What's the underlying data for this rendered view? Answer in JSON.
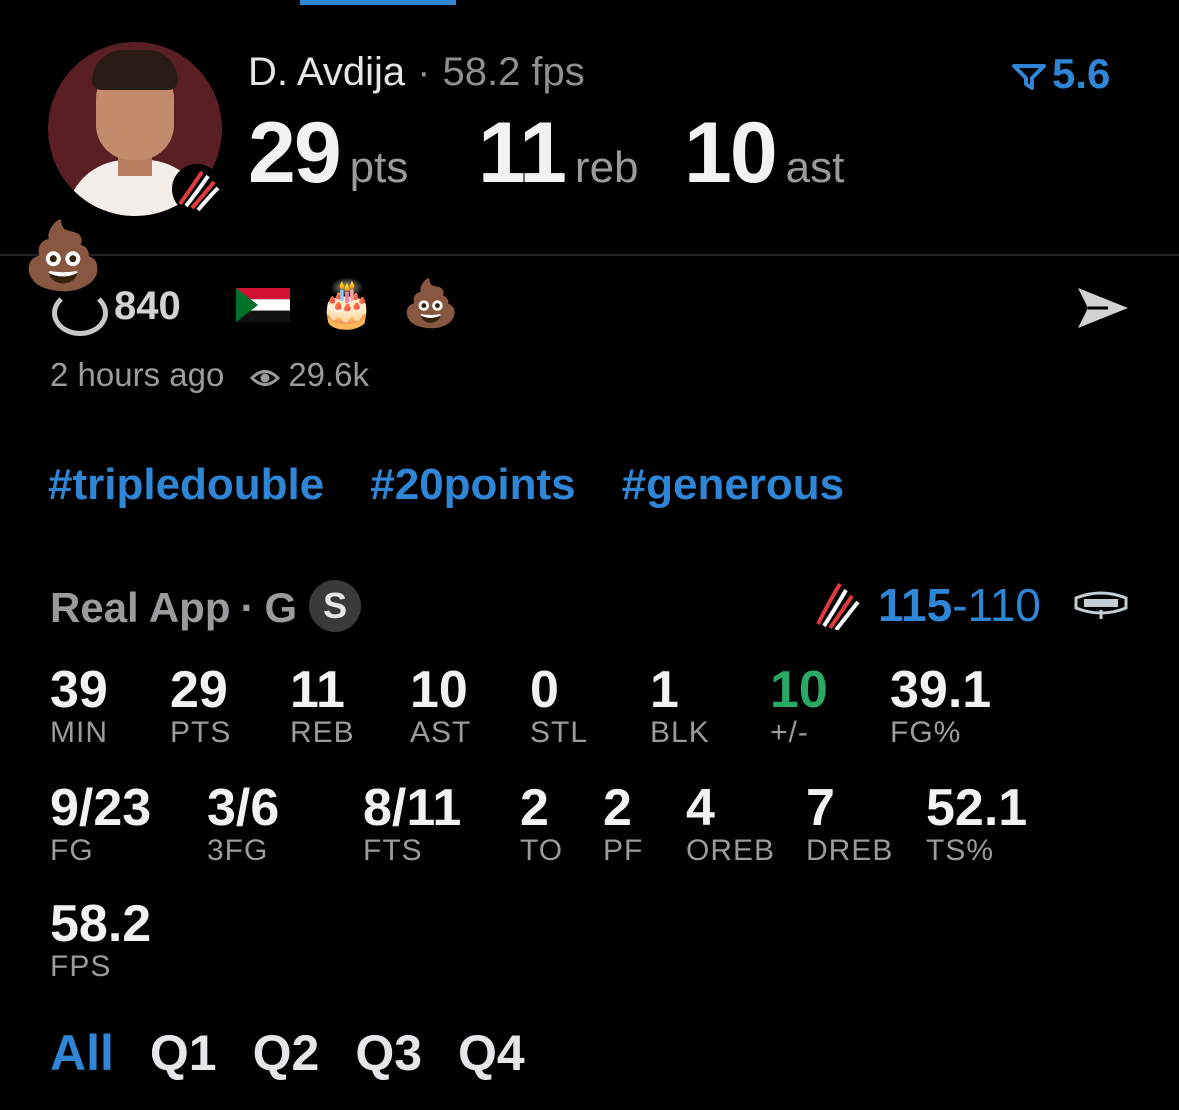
{
  "player": {
    "name": "D. Avdija",
    "fps_text": "58.2 fps",
    "vote_value": "5.6",
    "big_stats": [
      {
        "value": "29",
        "unit": "pts"
      },
      {
        "value": "11",
        "unit": "reb"
      },
      {
        "value": "10",
        "unit": "ast"
      }
    ]
  },
  "reactions": {
    "count": "840",
    "flag_icon": "sudan-flag-icon",
    "emojis": [
      "🎂",
      "💩"
    ],
    "featured_emoji": "💩"
  },
  "meta": {
    "time_ago": "2 hours ago",
    "views": "29.6k"
  },
  "tags": [
    "#tripledouble",
    "#20points",
    "#generous"
  ],
  "game": {
    "app_label": "Real App",
    "position": "G",
    "badge": "S",
    "score_home": "115",
    "score_away": "110",
    "dash": "-"
  },
  "stats_row1": [
    {
      "value": "39",
      "label": "MIN"
    },
    {
      "value": "29",
      "label": "PTS"
    },
    {
      "value": "11",
      "label": "REB"
    },
    {
      "value": "10",
      "label": "AST"
    },
    {
      "value": "0",
      "label": "STL"
    },
    {
      "value": "1",
      "label": "BLK"
    },
    {
      "value": "10",
      "label": "+/-"
    },
    {
      "value": "39.1",
      "label": "FG%"
    }
  ],
  "stats_row2": [
    {
      "value": "9/23",
      "label": "FG"
    },
    {
      "value": "3/6",
      "label": "3FG"
    },
    {
      "value": "8/11",
      "label": "FTS"
    },
    {
      "value": "2",
      "label": "TO"
    },
    {
      "value": "2",
      "label": "PF"
    },
    {
      "value": "4",
      "label": "OREB"
    },
    {
      "value": "7",
      "label": "DREB"
    },
    {
      "value": "52.1",
      "label": "TS%"
    }
  ],
  "stats_row3": [
    {
      "value": "58.2",
      "label": "FPS"
    }
  ],
  "periods": [
    "All",
    "Q1",
    "Q2",
    "Q3",
    "Q4"
  ],
  "colors": {
    "accent": "#2f86d6",
    "positive": "#2aa866",
    "muted": "#9a9a9f"
  }
}
